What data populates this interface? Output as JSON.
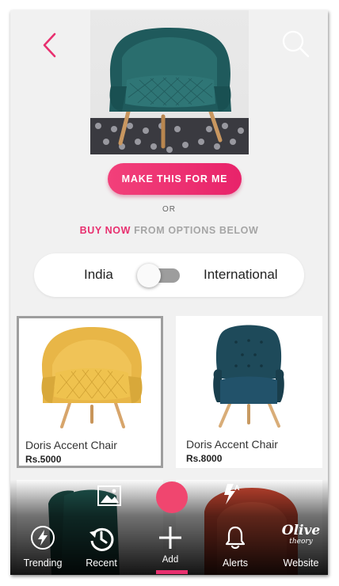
{
  "header": {
    "back": "back",
    "search": "search"
  },
  "cta": {
    "make_label": "MAKE THIS FOR ME",
    "or_label": "OR",
    "buy_now": "BUY NOW",
    "buy_rest": "FROM OPTIONS BELOW"
  },
  "region": {
    "left_label": "India",
    "right_label": "International",
    "selected": "India"
  },
  "products": [
    {
      "name": "Doris Accent Chair",
      "price": "Rs.5000",
      "color": "#e9b849",
      "selected": true
    },
    {
      "name": "Doris Accent Chair",
      "price": "Rs.8000",
      "color": "#1e4a5a",
      "selected": false
    }
  ],
  "nav": {
    "trending": "Trending",
    "recent": "Recent",
    "add": "Add",
    "alerts": "Alerts",
    "website": "Website",
    "logo_text_1": "Olive",
    "logo_text_2": "theory"
  },
  "colors": {
    "accent": "#e8306f",
    "background": "#f1f1f1"
  }
}
